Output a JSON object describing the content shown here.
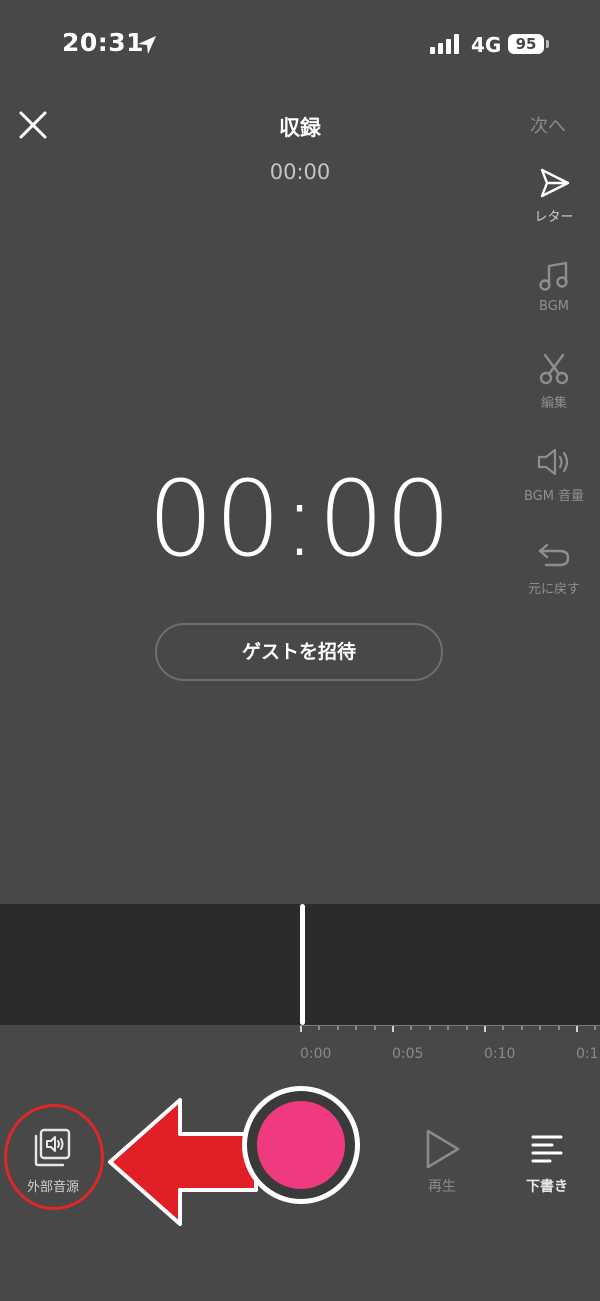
{
  "status_bar": {
    "time": "20:31",
    "network": "4G",
    "battery": "95"
  },
  "header": {
    "title": "収録",
    "next": "次へ",
    "elapsed": "00:00"
  },
  "tools": [
    {
      "label": "レター",
      "icon": "send-icon",
      "active": true
    },
    {
      "label": "BGM",
      "icon": "music-note-icon",
      "active": false
    },
    {
      "label": "編集",
      "icon": "scissors-icon",
      "active": false
    },
    {
      "label": "BGM 音量",
      "icon": "speaker-icon",
      "active": false
    },
    {
      "label": "元に戻す",
      "icon": "undo-icon",
      "active": false
    }
  ],
  "main": {
    "timer": "00:00",
    "invite_guest": "ゲストを招待"
  },
  "timeline": {
    "ticks": [
      "0:00",
      "0:05",
      "0:10",
      "0:1"
    ]
  },
  "bottom": {
    "external_audio": "外部音源",
    "play": "再生",
    "draft": "下書き"
  },
  "colors": {
    "record": "#f03a7f",
    "highlight": "#e02727",
    "background": "#484848"
  }
}
